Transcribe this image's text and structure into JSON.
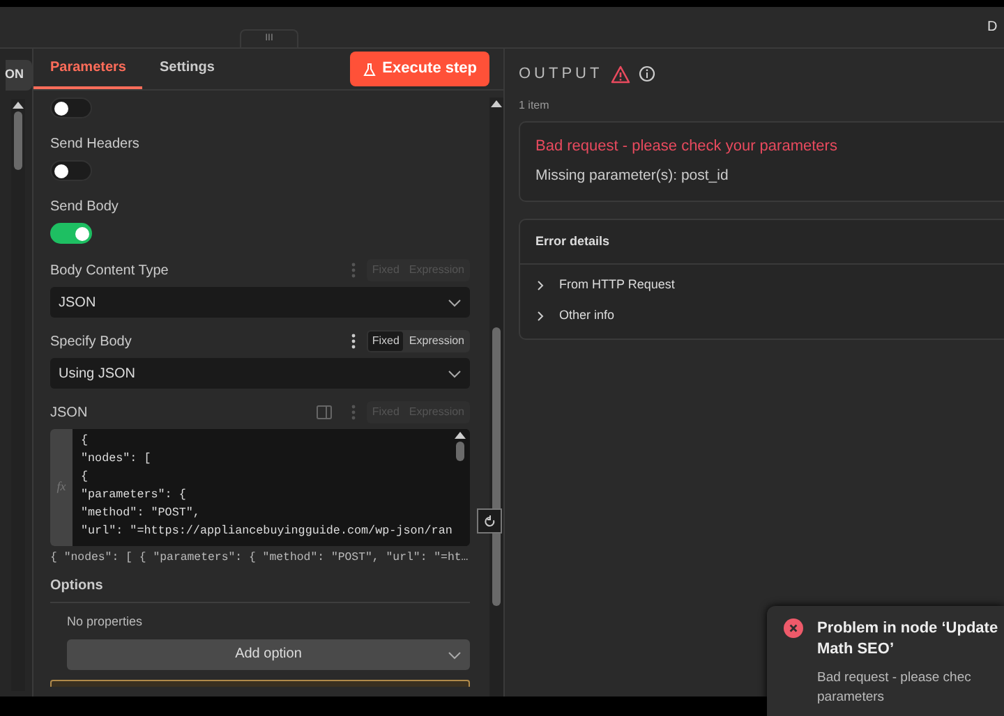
{
  "top_bar": {
    "handle": "III",
    "right_text": "D"
  },
  "left_strip": {
    "button": "ON"
  },
  "tabs": [
    {
      "label": "Parameters",
      "selected": true
    },
    {
      "label": "Settings",
      "selected": false
    }
  ],
  "execute_button": "Execute step",
  "parameters": [
    {
      "kind": "toggle",
      "on": false
    },
    {
      "kind": "toggle",
      "label": "Send Headers",
      "on": false
    },
    {
      "kind": "toggle",
      "label": "Send Body",
      "on": true
    },
    {
      "kind": "select",
      "label": "Body Content Type",
      "value": "JSON",
      "mode_active": false,
      "modes": [
        {
          "label": "Fixed",
          "selected": false
        },
        {
          "label": "Expression",
          "selected": false
        }
      ]
    },
    {
      "kind": "select",
      "label": "Specify Body",
      "value": "Using JSON",
      "mode_active": true,
      "modes": [
        {
          "label": "Fixed",
          "selected": true
        },
        {
          "label": "Expression",
          "selected": false
        }
      ]
    },
    {
      "kind": "code",
      "label": "JSON",
      "mode_active": false,
      "modes": [
        {
          "label": "Fixed",
          "selected": false
        },
        {
          "label": "Expression",
          "selected": false
        }
      ],
      "gutter": "fx",
      "lines": [
        "{",
        "\"nodes\": [",
        "{",
        "\"parameters\": {",
        "\"method\": \"POST\",",
        "\"url\": \"=https://appliancebuyingguide.com/wp-json/ran"
      ],
      "preview": "{ \"nodes\": [ { \"parameters\": { \"method\": \"POST\", \"url\": \"=ht…"
    }
  ],
  "options": {
    "title": "Options",
    "empty": "No properties",
    "button": "Add option"
  },
  "output": {
    "title": "OUTPUT",
    "count": "1 item",
    "error_title": "Bad request - please check your parameters",
    "error_message": "Missing parameter(s): post_id",
    "details_title": "Error details",
    "details": [
      {
        "label": "From HTTP Request",
        "expanded": false
      },
      {
        "label": "Other info",
        "expanded": false
      }
    ]
  },
  "toast": {
    "title_lines": [
      "Problem in node ‘Update",
      "Math SEO’"
    ],
    "message_lines": [
      "Bad request - please chec",
      "parameters"
    ]
  }
}
